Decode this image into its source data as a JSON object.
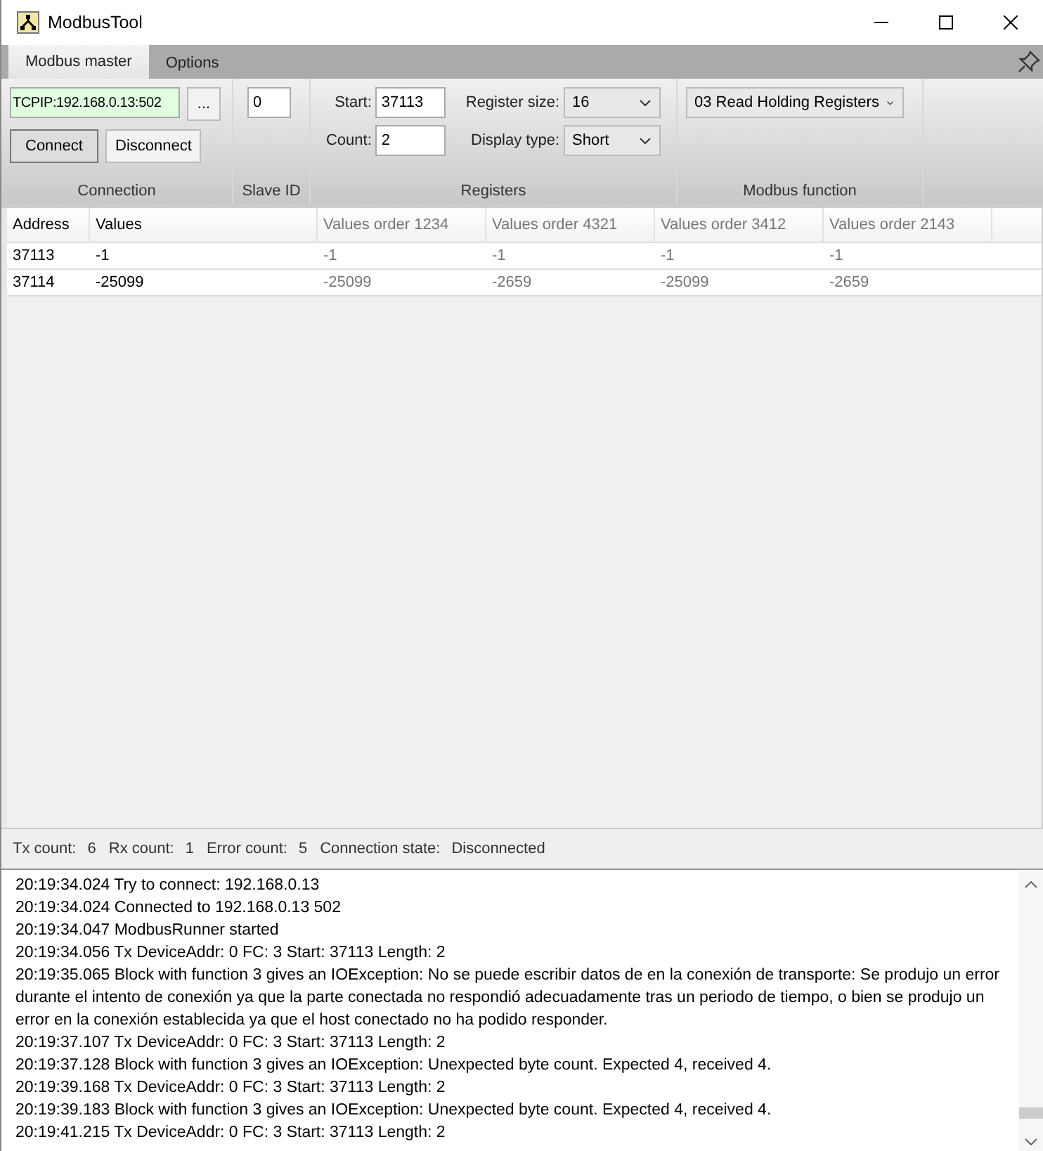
{
  "window": {
    "title": "ModbusTool"
  },
  "tabs": [
    {
      "label": "Modbus master",
      "selected": true
    },
    {
      "label": "Options",
      "selected": false
    }
  ],
  "ribbon": {
    "connection": {
      "address": "TCPIP:192.168.0.13:502",
      "browse": "...",
      "buttons": [
        "Connect",
        "Disconnect"
      ],
      "label": "Connection"
    },
    "slave_id": {
      "value": "0",
      "label": "Slave ID"
    },
    "registers": {
      "start_label": "Start:",
      "start": "37113",
      "count_label": "Count:",
      "count": "2",
      "register_size_label": "Register size:",
      "register_size": "16",
      "display_type_label": "Display type:",
      "display_type": "Short",
      "label": "Registers"
    },
    "modbus_function": {
      "value": "03 Read Holding Registers",
      "label": "Modbus function"
    }
  },
  "table": {
    "columns": [
      {
        "label": "Address",
        "kind": "main"
      },
      {
        "label": "Values",
        "kind": "main"
      },
      {
        "label": "Values order 1234",
        "kind": "order"
      },
      {
        "label": "Values order 4321",
        "kind": "order"
      },
      {
        "label": "Values order 3412",
        "kind": "order"
      },
      {
        "label": "Values order 2143",
        "kind": "order"
      }
    ],
    "rows": [
      [
        "37113",
        "-1",
        "-1",
        "-1",
        "-1",
        "-1"
      ],
      [
        "37114",
        "-25099",
        "-25099",
        "-2659",
        "-25099",
        "-2659"
      ]
    ]
  },
  "status_bar": [
    {
      "label": "Tx count:",
      "value": "6"
    },
    {
      "label": "Rx count:",
      "value": "1"
    },
    {
      "label": "Error count:",
      "value": "5"
    },
    {
      "label": "Connection state:",
      "value": "Disconnected"
    }
  ],
  "log": [
    "20:19:34.024 Try to connect: 192.168.0.13",
    "20:19:34.024 Connected to 192.168.0.13 502",
    "20:19:34.047 ModbusRunner started",
    "20:19:34.056 Tx DeviceAddr: 0 FC: 3 Start: 37113 Length: 2",
    "20:19:35.065 Block with function 3 gives an IOException: No se puede escribir datos de en la conexión de transporte: Se produjo un error durante el intento de conexión ya que la parte conectada no respondió adecuadamente tras un periodo de tiempo, o bien se produjo un error en la conexión establecida ya que el host conectado no ha podido responder.",
    "20:19:37.107 Tx DeviceAddr: 0 FC: 3 Start: 37113 Length: 2",
    "20:19:37.128 Block with function 3 gives an IOException: Unexpected byte count. Expected 4, received 4.",
    "20:19:39.168 Tx DeviceAddr: 0 FC: 3 Start: 37113 Length: 2",
    "20:19:39.183 Block with function 3 gives an IOException: Unexpected byte count. Expected 4, received 4.",
    "20:19:41.215 Tx DeviceAddr: 0 FC: 3 Start: 37113 Length: 2"
  ]
}
